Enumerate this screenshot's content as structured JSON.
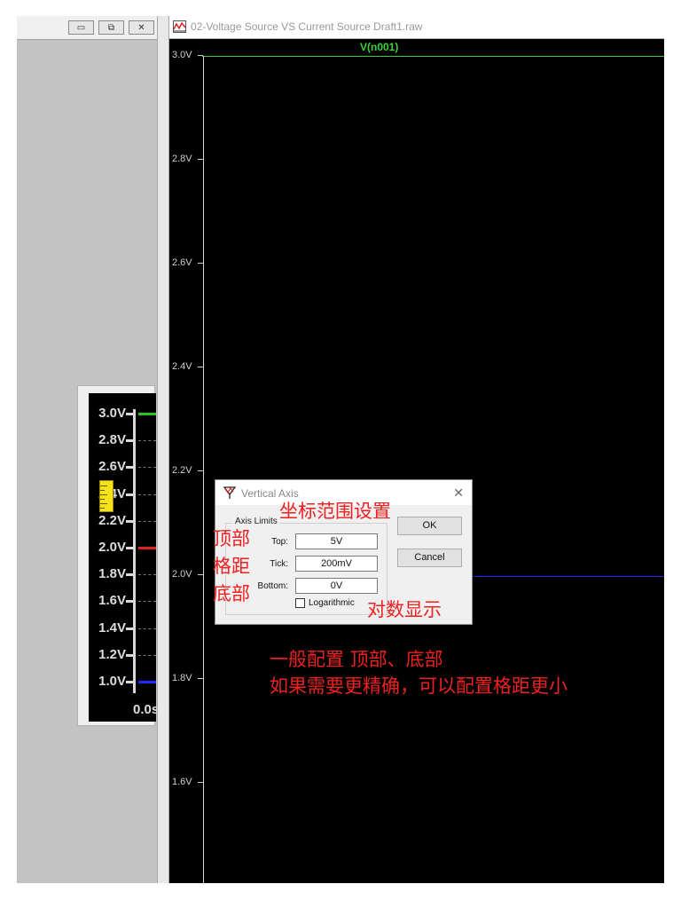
{
  "mdi_buttons": {
    "minimize": "▭",
    "restore": "⧉",
    "close": "✕"
  },
  "waveform_window": {
    "title": "02-Voltage Source VS Current Source Draft1.raw",
    "trace_label": "V(n001)",
    "y_ticks": [
      "3.0V",
      "2.8V",
      "2.6V",
      "2.4V",
      "2.2V",
      "2.0V",
      "1.8V",
      "1.6V"
    ],
    "trace_color": "#3cc93c",
    "blue_trace_color": "#1a2cff"
  },
  "inset": {
    "y_ticks": [
      "3.0V",
      "2.8V",
      "2.6V",
      "2.4V",
      "2.2V",
      "2.0V",
      "1.8V",
      "1.6V",
      "1.4V",
      "1.2V",
      "1.0V"
    ],
    "time_label": "0.0s",
    "marker_colors": {
      "3.0V": "#22c522",
      "2.0V": "#e02020",
      "1.0V": "#1a2cff"
    }
  },
  "dialog": {
    "title": "Vertical Axis",
    "group_label": "Axis Limits",
    "fields": {
      "top": {
        "label": "Top:",
        "value": "5V"
      },
      "tick": {
        "label": "Tick:",
        "value": "200mV"
      },
      "bottom": {
        "label": "Bottom:",
        "value": "0V"
      }
    },
    "logarithmic_label": "Logarithmic",
    "logarithmic_checked": false,
    "ok_label": "OK",
    "cancel_label": "Cancel",
    "close_glyph": "✕"
  },
  "annotations": {
    "range_setting": "坐标范围设置",
    "top": "顶部",
    "tick": "格距",
    "bottom": "底部",
    "log_display": "对数显示",
    "note_line1": "一般配置 顶部、底部",
    "note_line2": "如果需要更精确，可以配置格距更小",
    "color": "#ee2020"
  }
}
